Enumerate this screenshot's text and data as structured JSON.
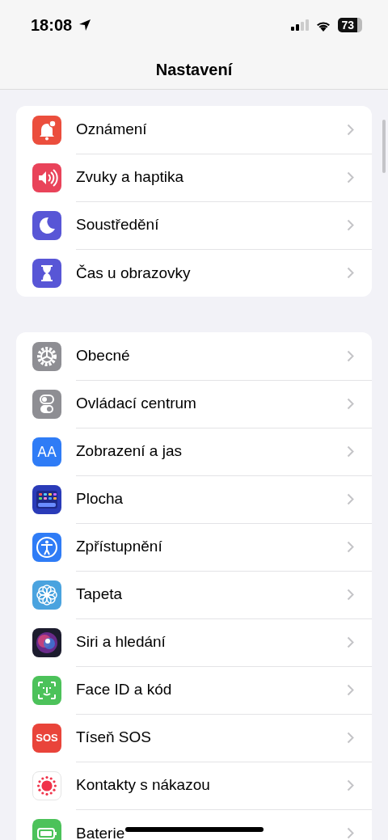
{
  "status_bar": {
    "time": "18:08",
    "battery": "73"
  },
  "title": "Nastavení",
  "groups": [
    {
      "items": [
        {
          "label": "Oznámení",
          "kind": "bell",
          "color": "#eb4e3d"
        },
        {
          "label": "Zvuky a haptika",
          "kind": "speaker",
          "color": "#e9435a"
        },
        {
          "label": "Soustředění",
          "kind": "moon",
          "color": "#5856d6"
        },
        {
          "label": "Čas u obrazovky",
          "kind": "hourglass",
          "color": "#5856d6"
        }
      ]
    },
    {
      "items": [
        {
          "label": "Obecné",
          "kind": "gear",
          "color": "#8e8e93"
        },
        {
          "label": "Ovládací centrum",
          "kind": "toggles",
          "color": "#8e8e93"
        },
        {
          "label": "Zobrazení a jas",
          "kind": "text",
          "color": "#2f7cf6",
          "icon_text": "AA"
        },
        {
          "label": "Plocha",
          "kind": "grid",
          "color": "#2a3bb8"
        },
        {
          "label": "Zpřístupnění",
          "kind": "person",
          "color": "#2f7cf6"
        },
        {
          "label": "Tapeta",
          "kind": "flower",
          "color": "#4aa3df"
        },
        {
          "label": "Siri a hledání",
          "kind": "orb",
          "color": "#1c1c2e"
        },
        {
          "label": "Face ID a kód",
          "kind": "face",
          "color": "#4cc25a"
        },
        {
          "label": "Tíseň SOS",
          "kind": "text",
          "color": "#e9443a",
          "icon_text": "SOS"
        },
        {
          "label": "Kontakty s nákazou",
          "kind": "dots",
          "color": "#ffffff"
        },
        {
          "label": "Baterie",
          "kind": "battery",
          "color": "#4cc25a"
        }
      ]
    }
  ]
}
